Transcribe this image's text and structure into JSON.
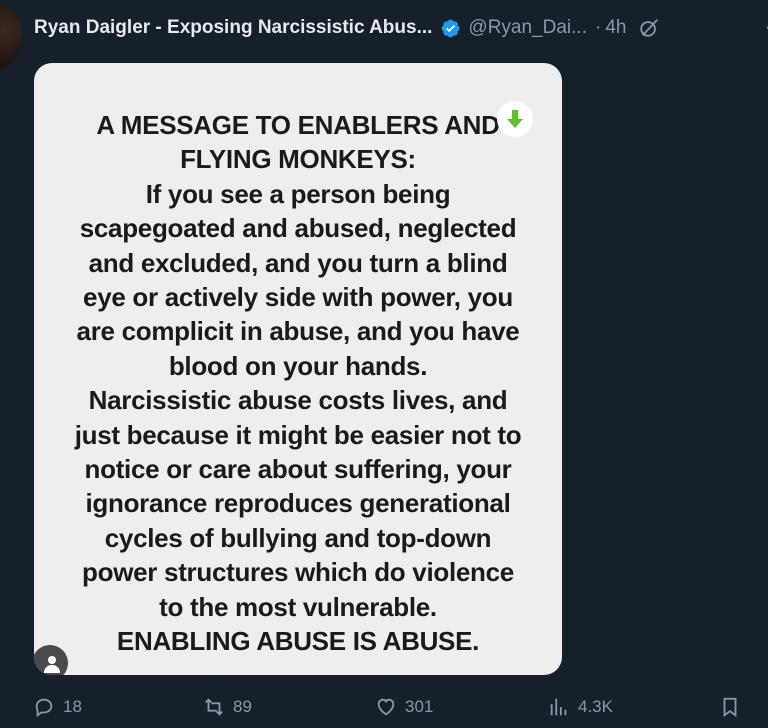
{
  "tweet": {
    "author_name": "Ryan Daigler - Exposing Narcissistic Abus...",
    "handle": "@Ryan_Dai...",
    "separator": "·",
    "time": "4h",
    "more": "·"
  },
  "media": {
    "message_lines": [
      "A MESSAGE TO ENABLERS AND",
      "FLYING MONKEYS:",
      "If you see a person being",
      "scapegoated and abused, neglected",
      "and excluded, and you turn a blind",
      "eye or actively side with power, you",
      "are complicit in abuse, and you have",
      "blood on your hands.",
      "Narcissistic abuse costs lives, and",
      "just because it might be easier not to",
      "notice or care about suffering, your",
      "ignorance reproduces generational",
      "cycles of bullying and top-down",
      "power structures which do violence",
      "to the most vulnerable.",
      "ENABLING ABUSE IS ABUSE."
    ],
    "download_icon": "green-down-arrow-icon"
  },
  "actions": {
    "replies": "18",
    "retweets": "89",
    "likes": "301",
    "views": "4.3K"
  },
  "colors": {
    "background": "#15202b",
    "card": "#eeeeee",
    "verified": "#1d9bf0",
    "muted": "#8b98a5",
    "download_arrow": "#5fbf2c"
  }
}
